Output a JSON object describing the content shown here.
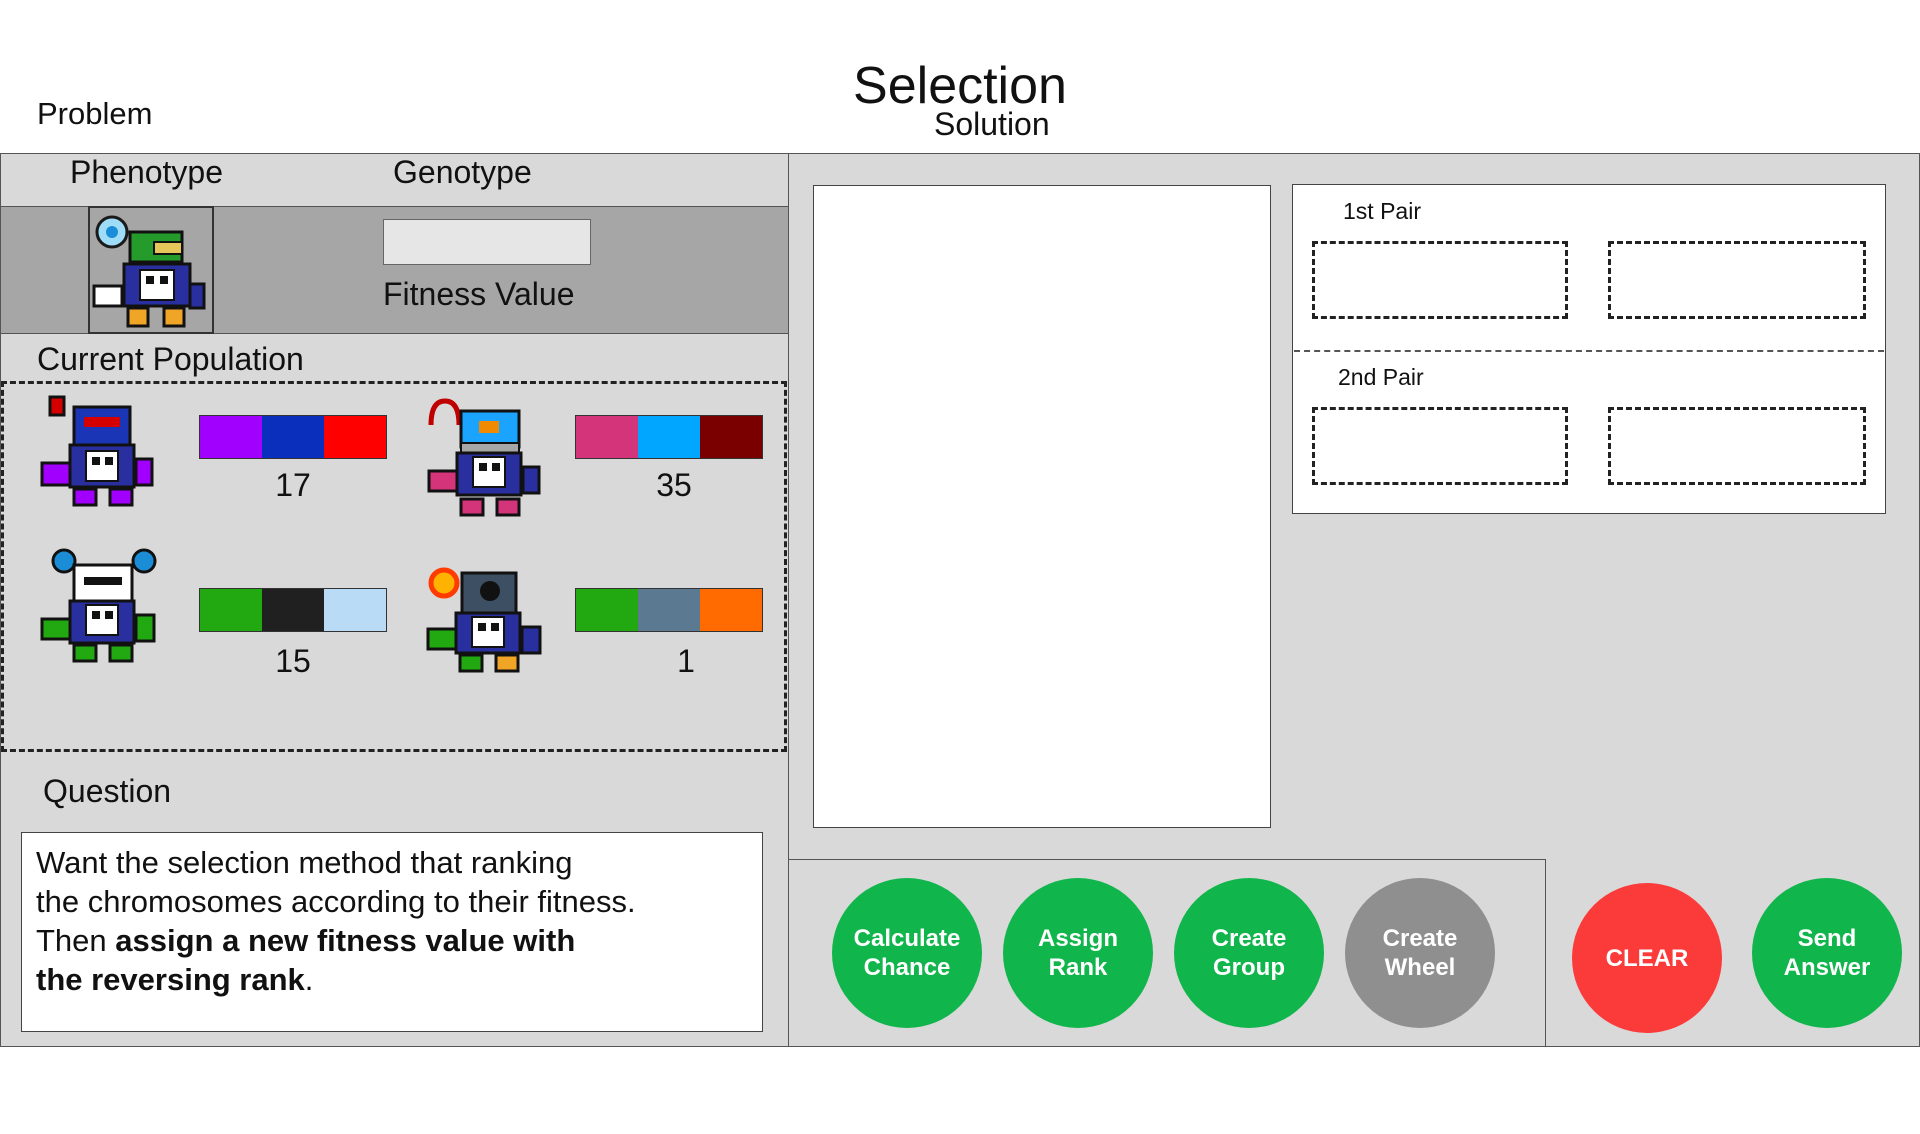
{
  "title": "Selection",
  "subtitle": "Solution",
  "problem_label": "Problem",
  "problem": {
    "phenotype_header": "Phenotype",
    "genotype_header": "Genotype",
    "fitness_label": "Fitness Value",
    "genotype_value": "",
    "current_population_label": "Current Population",
    "population": [
      {
        "colors": [
          "#a100ff",
          "#0a2fbd",
          "#ff0000"
        ],
        "fitness": "17"
      },
      {
        "colors": [
          "#d3347a",
          "#00a6ff",
          "#7a0000"
        ],
        "fitness": "35"
      },
      {
        "colors": [
          "#22a811",
          "#202020",
          "#b9dbf5"
        ],
        "fitness": "15"
      },
      {
        "colors": [
          "#22a811",
          "#5b7a91",
          "#ff6b00"
        ],
        "fitness": "1"
      }
    ]
  },
  "question": {
    "label": "Question",
    "line1": "Want the selection method that ranking",
    "line2": "the chromosomes according to their fitness.",
    "line3_plain": "Then ",
    "line3_bold": "assign a new fitness value with",
    "line4_bold": "the reversing rank",
    "line4_end": "."
  },
  "pairs": {
    "first_label": "1st Pair",
    "second_label": "2nd Pair"
  },
  "buttons": {
    "calculate": "Calculate\nChance",
    "assign": "Assign\nRank",
    "create_group": "Create\nGroup",
    "create_wheel": "Create\nWheel",
    "clear": "CLEAR",
    "send": "Send\nAnswer"
  },
  "colors": {
    "green_button": "#10b54b",
    "disabled_button": "#8f8f8f",
    "clear_button": "#fb3a3a",
    "panel_bg": "#d9d9d9",
    "band_bg": "#a6a6a6"
  },
  "icons": [
    "robot-sprite-icon"
  ]
}
